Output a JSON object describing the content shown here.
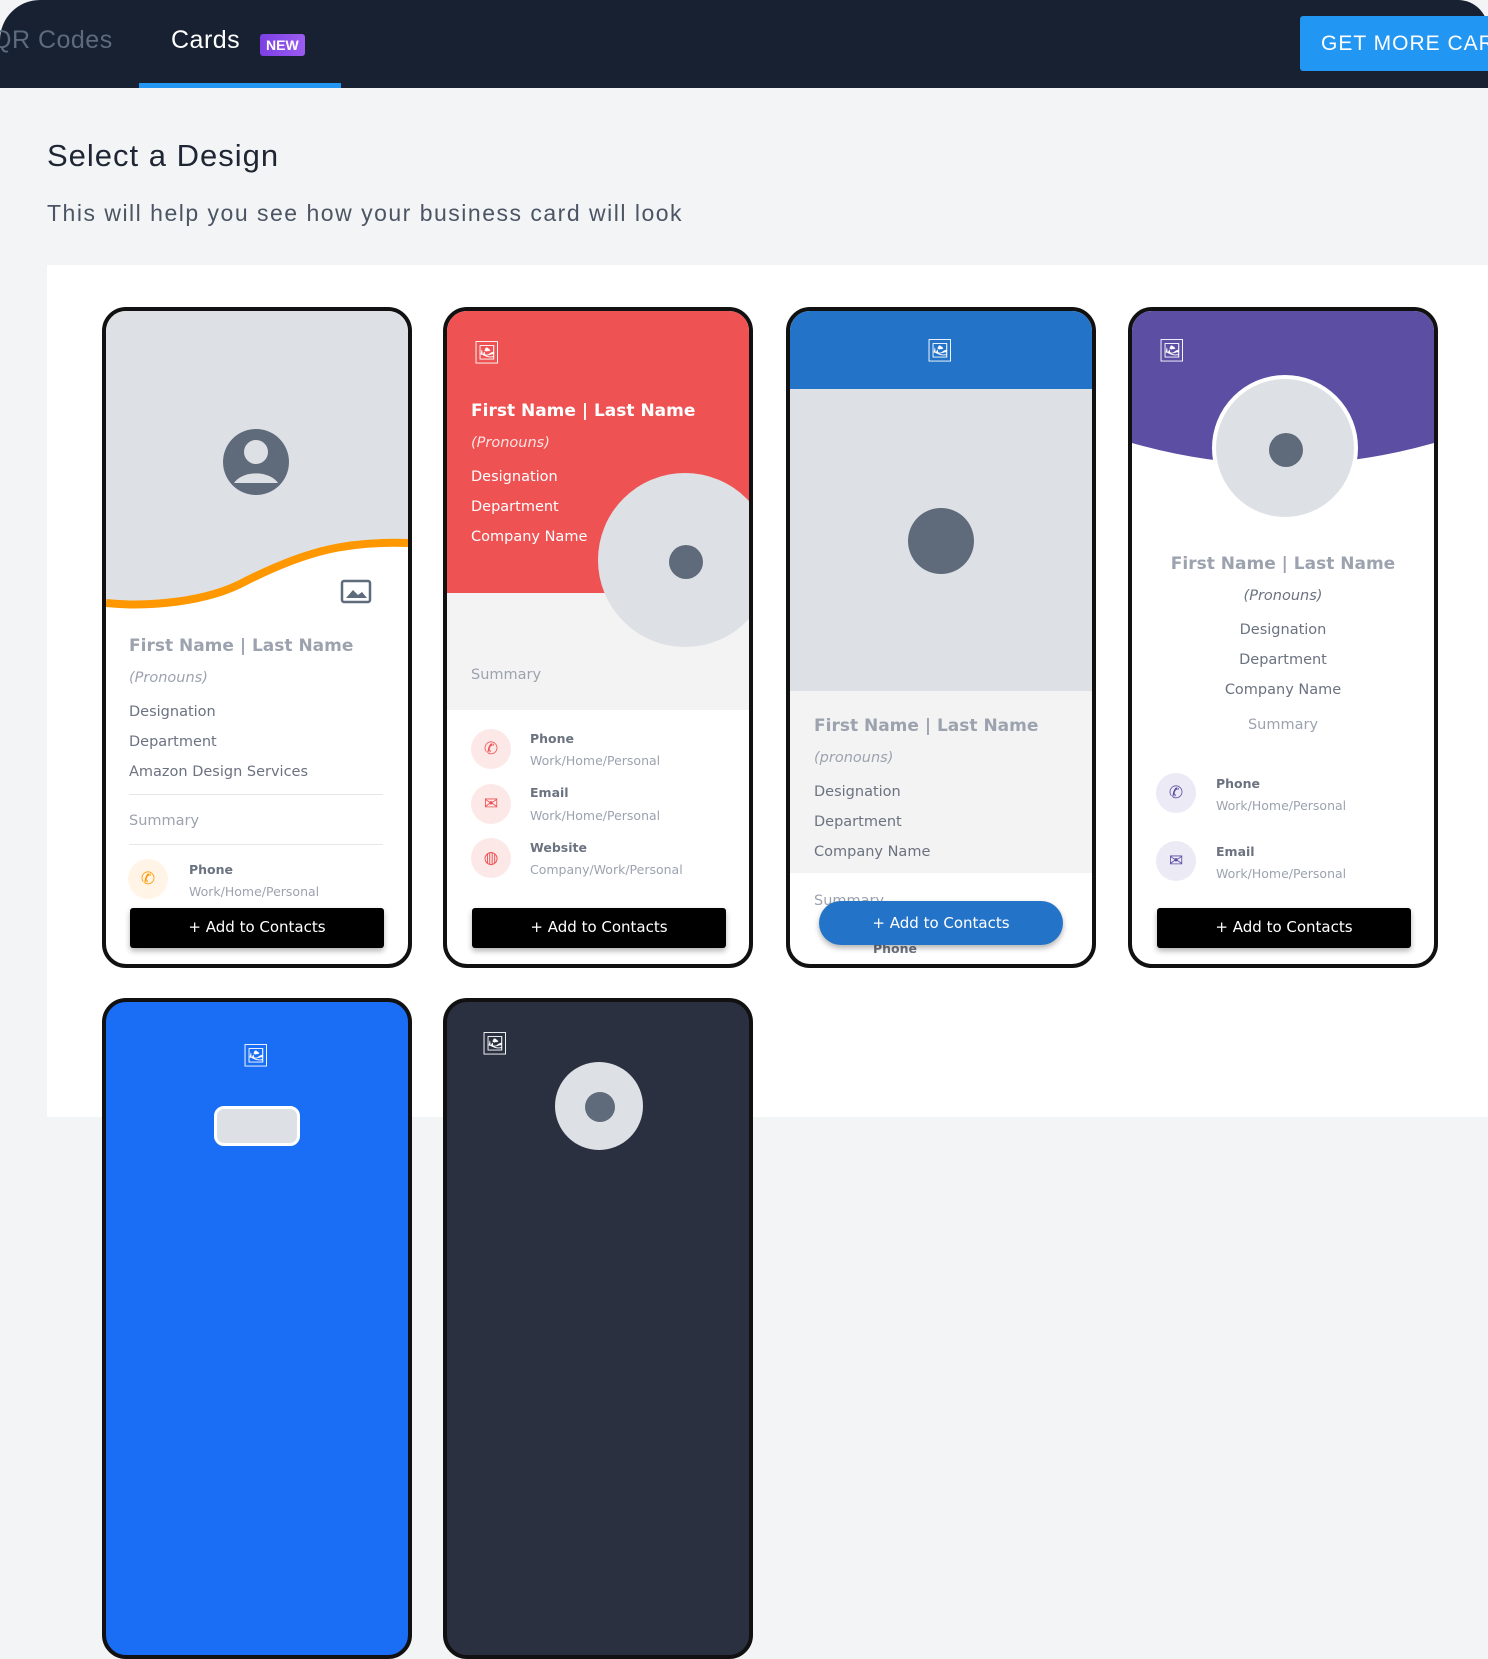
{
  "nav": {
    "tabs": [
      {
        "label": "QR Codes"
      },
      {
        "label": "Cards",
        "badge": "NEW"
      }
    ],
    "cta": "GET MORE CARDS"
  },
  "page": {
    "title": "Select a Design",
    "subtitle": "This will help you see how your business card will look"
  },
  "common": {
    "name": "First Name | Last Name",
    "pronouns": "(Pronouns)",
    "pronouns_lower": "(pronouns)",
    "designation": "Designation",
    "department": "Department",
    "company": "Company Name",
    "company_amazon": "Amazon Design Services",
    "summary": "Summary",
    "add": "+ Add to Contacts",
    "phone": "Phone",
    "email": "Email",
    "website": "Website",
    "whp": "Work/Home/Personal",
    "cwp": "Company/Work/Personal"
  },
  "colors": {
    "accent": "#2196f3",
    "red": "#ee5253",
    "blue": "#2373c8",
    "purple": "#5b4ea3",
    "orange": "#ff9800",
    "bright_blue": "#1a6ef5",
    "dark": "#2b3040"
  }
}
